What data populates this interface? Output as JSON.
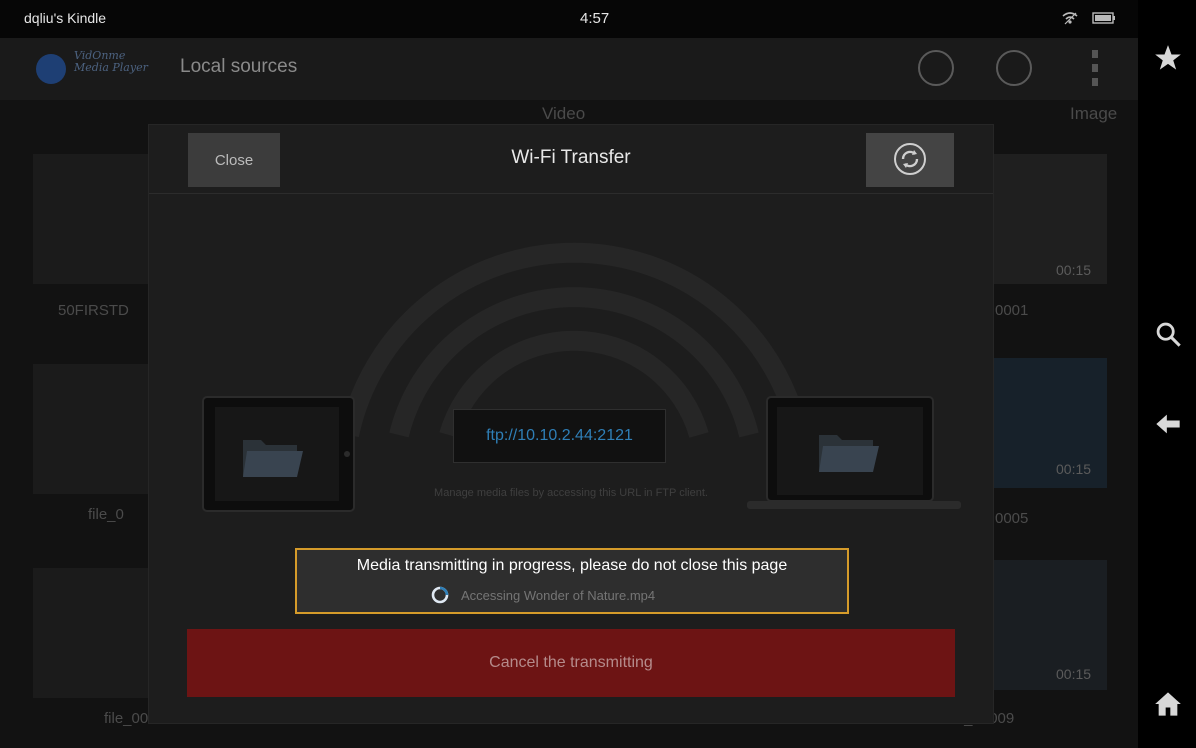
{
  "status_bar": {
    "device_name": "dqliu's Kindle",
    "time": "4:57",
    "icons": [
      "wifi-icon",
      "battery-icon"
    ]
  },
  "nav_rail": {
    "icons": [
      "star-icon",
      "search-icon",
      "back-arrow-icon",
      "home-icon"
    ]
  },
  "app_bar": {
    "logo_text_line1": "VidOnme",
    "logo_text_line2": "Media Player",
    "title": "Local sources",
    "actions": [
      "list-icon",
      "sync-icon",
      "overflow-menu-icon"
    ]
  },
  "tabs": [
    "Video",
    "Image"
  ],
  "background_items": [
    {
      "label": "50FIRSTD",
      "duration": ""
    },
    {
      "label": "0001",
      "duration": "00:15"
    },
    {
      "label": "file_0",
      "duration": ""
    },
    {
      "label": "0005",
      "duration": "00:15"
    },
    {
      "label": "file_00",
      "duration": ""
    },
    {
      "label": "file_00009",
      "duration": "00:15"
    }
  ],
  "dialog": {
    "close_label": "Close",
    "title": "Wi-Fi Transfer",
    "refresh_icon": "refresh-icon",
    "ftp_url": "ftp://10.10.2.44:2121",
    "hint": "Manage media files by accessing this URL in FTP client.",
    "progress_message": "Media transmitting in progress, please do not close this page",
    "progress_detail": "Accessing Wonder of Nature.mp4",
    "cancel_label": "Cancel the transmitting"
  }
}
